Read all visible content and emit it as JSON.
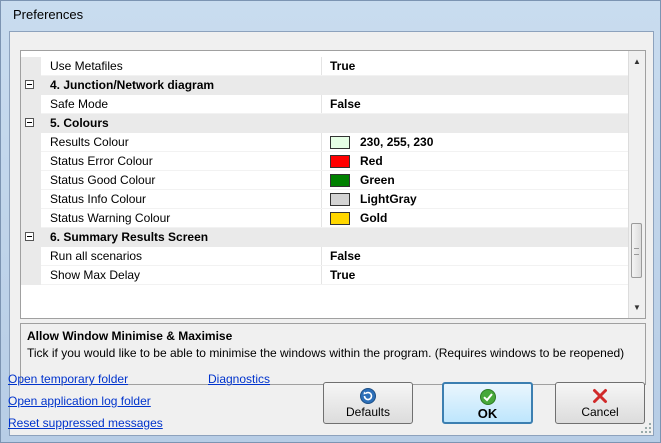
{
  "window": {
    "title": "Preferences"
  },
  "grid": {
    "rows": [
      {
        "type": "prop",
        "name": "Use Metafiles",
        "value": "True"
      },
      {
        "type": "cat",
        "name": "4. Junction/Network diagram"
      },
      {
        "type": "prop",
        "name": "Safe Mode",
        "value": "False"
      },
      {
        "type": "cat",
        "name": "5. Colours"
      },
      {
        "type": "prop",
        "name": "Results Colour",
        "value": "230, 255, 230",
        "swatch": "#e6ffe6"
      },
      {
        "type": "prop",
        "name": "Status Error Colour",
        "value": "Red",
        "swatch": "#ff0000"
      },
      {
        "type": "prop",
        "name": "Status Good Colour",
        "value": "Green",
        "swatch": "#008000"
      },
      {
        "type": "prop",
        "name": "Status Info Colour",
        "value": "LightGray",
        "swatch": "#d3d3d3"
      },
      {
        "type": "prop",
        "name": "Status Warning Colour",
        "value": "Gold",
        "swatch": "#ffd700"
      },
      {
        "type": "cat",
        "name": "6. Summary Results Screen"
      },
      {
        "type": "prop",
        "name": "Run all scenarios",
        "value": "False"
      },
      {
        "type": "prop",
        "name": "Show Max Delay",
        "value": "True"
      }
    ]
  },
  "description": {
    "title": "Allow Window Minimise & Maximise",
    "text": "Tick if you would like to be able to minimise the windows within the program. (Requires windows to be reopened)"
  },
  "links": {
    "open_temp": "Open temporary folder",
    "diagnostics": "Diagnostics",
    "open_log": "Open application log folder",
    "reset_msgs": "Reset suppressed messages"
  },
  "buttons": {
    "defaults": "Defaults",
    "ok": "OK",
    "cancel": "Cancel"
  },
  "icons": {
    "defaults": "reset-arrow-icon",
    "ok": "green-check-icon",
    "cancel": "red-x-icon"
  },
  "colors": {
    "link": "#0033cc",
    "ok_border": "#3c7fb1"
  }
}
